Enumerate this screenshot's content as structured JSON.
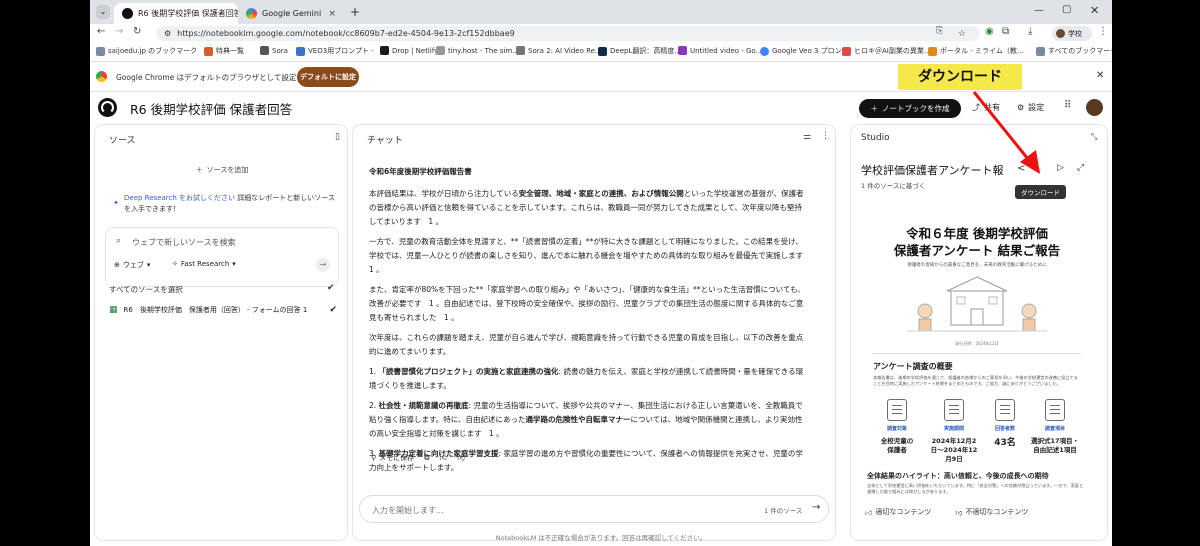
{
  "tabs": [
    {
      "title": "R6 後期学校評価 保護者回答",
      "active": true
    },
    {
      "title": "Google Gemini",
      "active": false
    }
  ],
  "omnibox": {
    "url": "https://notebooklm.google.com/notebook/cc8609b7-ed2e-4504-9e13-2cf152dbbae9"
  },
  "profile_label": "学校",
  "bookmarks": [
    "saijoedu.jp のブックマーク",
    "特典一覧",
    "Sora",
    "VEO3用プロンプト - G...",
    "Drop | Netlify",
    "tiny.host - The sim...",
    "Sora 2: AI Video Re...",
    "DeepL翻訳：高精度...",
    "Untitled video - Go...",
    "Google Veo 3 プロン...",
    "ヒロキ＠AI副業の異業...",
    "ポータル - ミライム（教..."
  ],
  "bookmarks_all": "すべてのブックマーク",
  "infobar": {
    "message": "Google Chrome はデフォルトのブラウザとして設定されていません",
    "button": "デフォルトに設定"
  },
  "annotation": {
    "callout": "ダウンロード",
    "tooltip": "ダウンロード"
  },
  "app": {
    "notebook_title": "R6 後期学校評価 保護者回答",
    "create_button": "ノートブックを作成",
    "share": "共有",
    "settings": "設定"
  },
  "sources": {
    "title": "ソース",
    "add": "ソースを追加",
    "deep_research_link": "Deep Research をお試しください",
    "deep_research_text": "詳細なレポートと新しいソースを入手できます！",
    "search_placeholder": "ウェブで新しいソースを検索",
    "web_chip": "ウェブ",
    "fast_chip": "Fast Research",
    "select_all": "すべてのソースを選択",
    "items": [
      "R6　後期学校評価　保護者用（回答） - フォームの回答 1"
    ]
  },
  "chat": {
    "title": "チャット",
    "heading": "令和6年度後期学校評価報告書",
    "p1a": "本評価結果は、学校が日頃から注力している",
    "p1b": "安全管理、地域・家庭との連携、および情報公開",
    "p1c": "といった学校運営の基盤が、保護者の皆様から高い評価と信頼を得ていることを示しています。これらは、教職員一同が努力してきた成果として、次年度以降も堅持してまいります",
    "p2": "一方で、児童の教育活動全体を見渡すと、**「読書習慣の定着」**が特に大きな課題として明確になりました。この結果を受け、学校では、児童一人ひとりが読書の楽しさを知り、進んで本に触れる機会を増やすための具体的な取り組みを最優先で実施します",
    "p3": "また、肯定率が80%を下回った**「家庭学習への取り組み」や「あいさつ」、「健康的な食生活」**といった生活習慣についても、改善が必要です　1 。自由記述では、登下校時の安全確保や、挨拶の励行、児童クラブでの集団生活の態度に関する具体的なご意見も寄せられました",
    "p4": "次年度は、これらの課題を踏まえ、児童が自ら進んで学び、規範意識を持って行動できる児童の育成を目指し、以下の改善を重点的に進めてまいります。",
    "l1b": "「読書習慣化プロジェクト」の実施と家庭連携の強化",
    "l1": ": 読書の魅力を伝え、家庭と学校が連携して読書時間・量を確保できる環境づくりを推進します。",
    "l2b": "社会性・規範意識の再徹底",
    "l2a": ": 児童の生活指導について、挨拶や公共のマナー、集団生活における正しい言葉遣いを、全教職員で粘り強く指導します。特に、自由記述にあった",
    "l2c": "通学路の危険性や自転車マナー",
    "l2d": "については、地域や関係機関と連携し、より実効性の高い安全指導と対策を講じます",
    "l3b": "基礎学力定着に向けた家庭学習支援",
    "l3": ": 家庭学習の進め方や習慣化の重要性について、保護者への情報提供を充実させ、児童の学力向上をサポートします。",
    "cite": "1",
    "save_note": "メモに保存",
    "input_placeholder": "入力を開始します...",
    "source_count": "1 件のソース"
  },
  "studio": {
    "title": "Studio",
    "doc_title": "学校評価保護者アンケート報",
    "based_on": "1 件のソースに基づく",
    "card_title1": "令和６年度 後期学校評価",
    "card_title2": "保護者アンケート 結果ご報告",
    "card_sub": "保護者の皆様からの貴重なご意見を、未来の教育活動に繋げるために",
    "card_date": "発行日時：2024年12月",
    "section1": "アンケート調査の概要",
    "section1_text": "本報告書は、後期の学校評価を通じて、保護者の皆様からのご意見を伺い、今後の学校運営の改善に役立てることを目的に実施したアンケート結果をまとめたものです。ご協力、誠にありがとうございました。",
    "stats": [
      {
        "cap": "調査対象",
        "value": "全校児童の保護者"
      },
      {
        "cap": "実施期間",
        "value": "2024年12月2日〜2024年12月9日"
      },
      {
        "cap": "回答者数",
        "value": "43名"
      },
      {
        "cap": "調査項目",
        "value": "選択式17項目・自由記述1項目"
      }
    ],
    "section2": "全体結果のハイライト：高い信頼と、今後の成長への期待",
    "section2_text": "全体として学校運営に高い評価をいただいています。特に「安全対策」への信頼が際立っています。一方で、家庭と連携した取り組みには伸びしろがあります。",
    "good": "適切なコンテンツ",
    "bad": "不適切なコンテンツ"
  },
  "footer": "NotebookLM は不正確な場合があります。回答は再確認してください。"
}
